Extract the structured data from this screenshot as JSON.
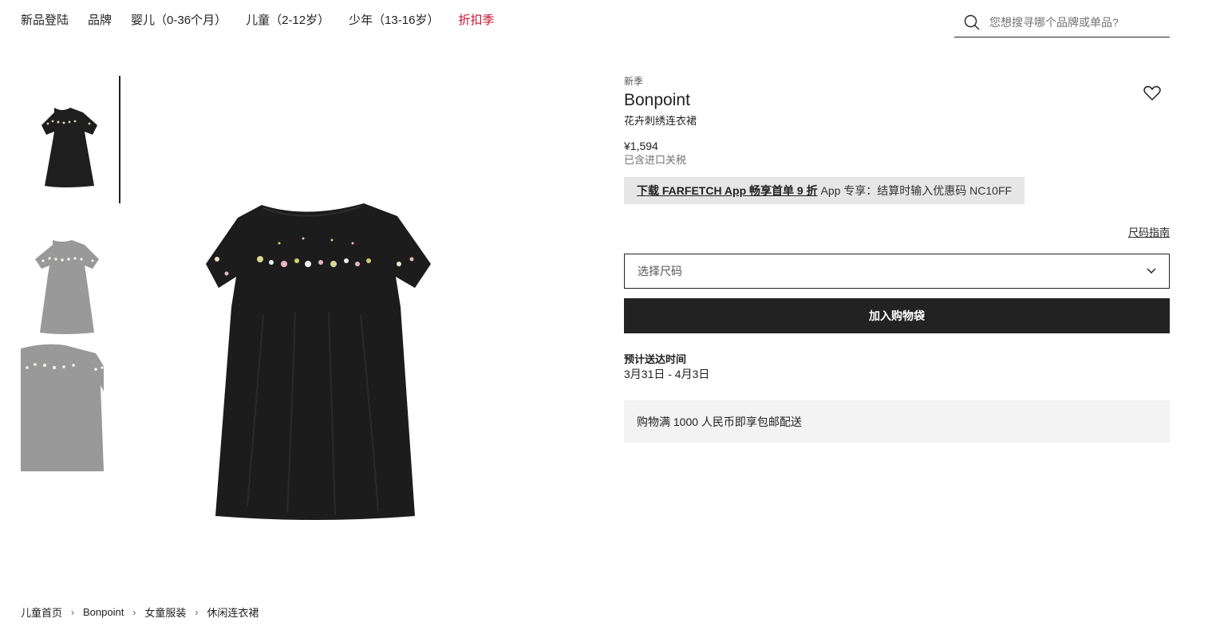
{
  "nav": {
    "items": [
      {
        "label": "新品登陆"
      },
      {
        "label": "品牌"
      },
      {
        "label": "婴儿（0-36个月）"
      },
      {
        "label": "儿童（2-12岁）"
      },
      {
        "label": "少年（13-16岁）"
      },
      {
        "label": "折扣季"
      }
    ],
    "sale_color": "#c8102e"
  },
  "search": {
    "placeholder": "您想搜寻哪个品牌或单品?",
    "icon": "search-icon"
  },
  "gallery": {
    "thumbnails": [
      {
        "icon": "dress-front-thumbnail",
        "selected": true
      },
      {
        "icon": "dress-back-thumbnail",
        "selected": false
      },
      {
        "icon": "dress-detail-thumbnail",
        "selected": false
      }
    ],
    "main_image": "black-embroidered-dress"
  },
  "product": {
    "label": "新季",
    "brand": "Bonpoint",
    "description": "花卉刺绣连衣裙",
    "price": "¥1,594",
    "tax_note": "已含进口关税",
    "promo": {
      "link_text": "下载 FARFETCH App 畅享首单 9 折",
      "text": " App 专享：结算时输入优惠码 NC10FF"
    },
    "size_guide": "尺码指南",
    "size_select": "选择尺码",
    "add_to_bag": "加入购物袋",
    "delivery_title": "预计送达时间",
    "delivery_date": "3月31日 - 4月3日",
    "shipping_note": "购物满 1000 人民币即享包邮配送",
    "wishlist_icon": "heart-icon"
  },
  "breadcrumb": [
    {
      "label": "儿童首页"
    },
    {
      "label": "Bonpoint"
    },
    {
      "label": "女童服装"
    },
    {
      "label": "休闲连衣裙"
    }
  ],
  "breadcrumb_sep": "›"
}
